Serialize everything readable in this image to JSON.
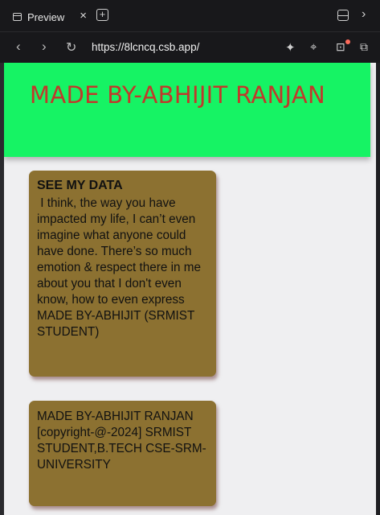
{
  "browser": {
    "tab_title": "Preview",
    "tab_close": "×",
    "new_tab": "+",
    "url": "https://8lcncq.csb.app/",
    "icons": [
      "preview-tab-icon",
      "close-icon",
      "new-tab-icon",
      "split-view-icon",
      "chevron-right-icon",
      "back-icon",
      "forward-icon",
      "refresh-icon",
      "sparkle-icon",
      "crosshair-icon",
      "terminal-icon",
      "popout-icon"
    ]
  },
  "page": {
    "hero_title": "MADE BY-ABHIJIT RANJAN",
    "card1": {
      "heading": "SEE MY DATA",
      "body": " I think, the way you have impacted my life, I can’t even imagine what anyone could have done. There’s so much emotion & respect there in me about you that I don't even know, how to even express MADE BY-ABHIJIT (SRMIST STUDENT)"
    },
    "card2": {
      "body": "MADE BY-ABHIJIT RANJAN [copyright-@-2024] SRMIST STUDENT,B.TECH CSE-SRM-UNIVERSITY"
    }
  },
  "colors": {
    "hero_bg": "#16f364",
    "hero_text": "#c0392b",
    "card_bg": "#8c7131",
    "page_bg": "#efeff1",
    "chrome_bg": "#18181b"
  }
}
